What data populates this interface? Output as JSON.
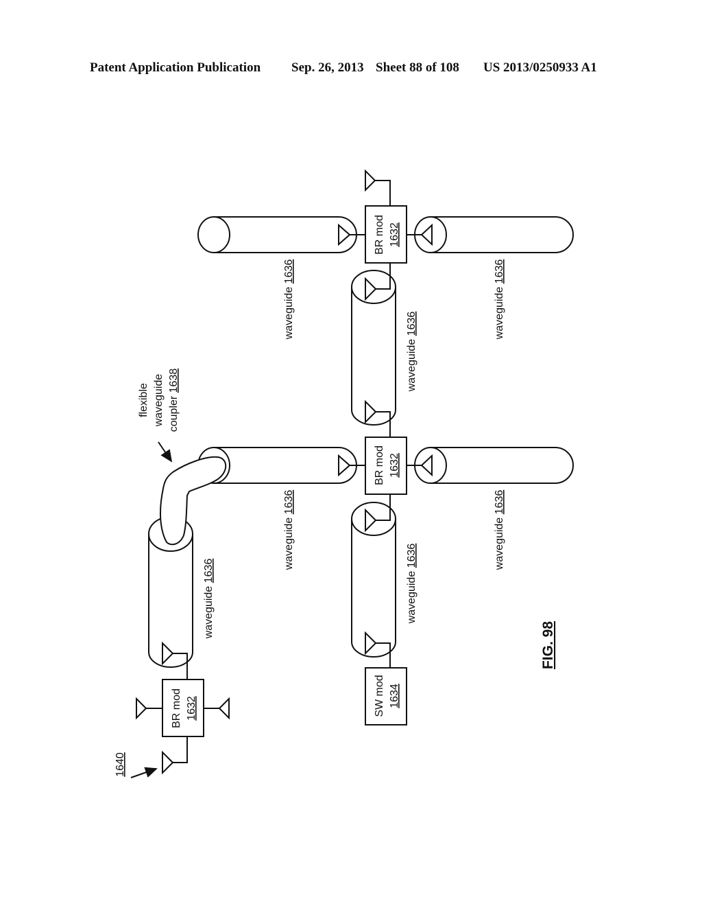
{
  "header": {
    "publication": "Patent Application Publication",
    "date": "Sep. 26, 2013",
    "sheet": "Sheet 88 of 108",
    "number": "US 2013/0250933 A1"
  },
  "figure": {
    "label": "FIG. 98",
    "system_ref": "1640",
    "coupler": {
      "line1": "flexible",
      "line2": "waveguide",
      "line3_text": "coupler ",
      "line3_ref": "1638"
    },
    "br_mod": {
      "name": "BR mod",
      "ref": "1632"
    },
    "sw_mod": {
      "name": "SW mod",
      "ref": "1634"
    },
    "waveguide": {
      "name": "waveguide ",
      "ref": "1636"
    }
  }
}
